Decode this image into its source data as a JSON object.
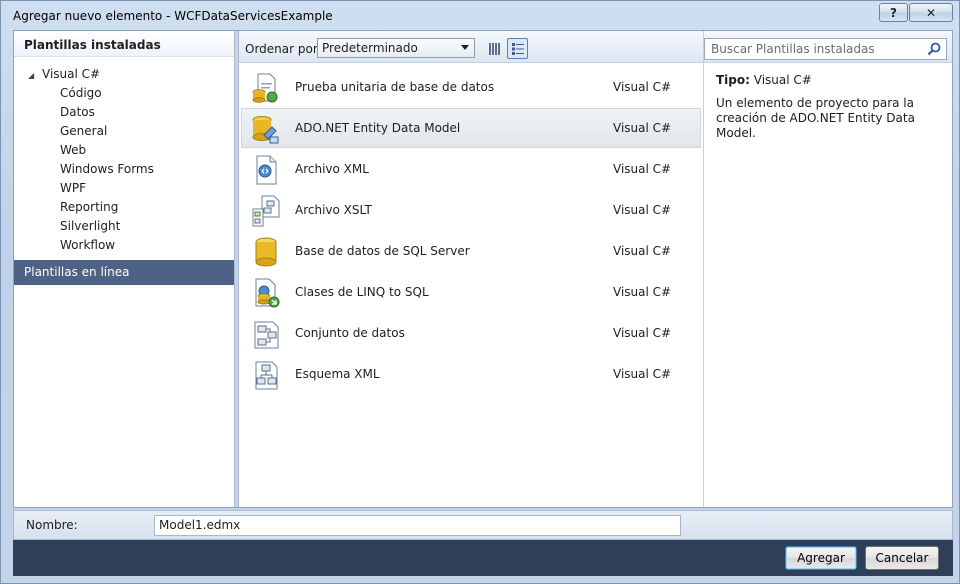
{
  "window": {
    "title": "Agregar nuevo elemento - WCFDataServicesExample",
    "help_label": "?",
    "close_label": "✕"
  },
  "left_panel": {
    "header": "Plantillas instaladas",
    "root": "Visual C#",
    "items": [
      "Código",
      "Datos",
      "General",
      "Web",
      "Windows Forms",
      "WPF",
      "Reporting",
      "Silverlight",
      "Workflow"
    ],
    "online": "Plantillas en línea"
  },
  "toolbar": {
    "sort_label": "Ordenar por:",
    "sort_value": "Predeterminado"
  },
  "templates": [
    {
      "name": "Prueba unitaria de base de datos",
      "language": "Visual C#",
      "icon": "database-unit-test-icon"
    },
    {
      "name": "ADO.NET Entity Data Model",
      "language": "Visual C#",
      "icon": "entity-data-model-icon",
      "selected": true
    },
    {
      "name": "Archivo XML",
      "language": "Visual C#",
      "icon": "xml-file-icon"
    },
    {
      "name": "Archivo XSLT",
      "language": "Visual C#",
      "icon": "xslt-file-icon"
    },
    {
      "name": "Base de datos de SQL Server",
      "language": "Visual C#",
      "icon": "sql-database-icon"
    },
    {
      "name": "Clases de LINQ to SQL",
      "language": "Visual C#",
      "icon": "linq-to-sql-icon"
    },
    {
      "name": "Conjunto de datos",
      "language": "Visual C#",
      "icon": "dataset-icon"
    },
    {
      "name": "Esquema XML",
      "language": "Visual C#",
      "icon": "xml-schema-icon"
    }
  ],
  "search": {
    "placeholder": "Buscar Plantillas instaladas"
  },
  "details": {
    "type_label": "Tipo:",
    "type_value": "Visual C#",
    "description": "Un elemento de proyecto para la creación de ADO.NET Entity Data Model."
  },
  "name_field": {
    "label": "Nombre:",
    "value": "Model1.edmx"
  },
  "buttons": {
    "ok": "Agregar",
    "cancel": "Cancelar"
  }
}
